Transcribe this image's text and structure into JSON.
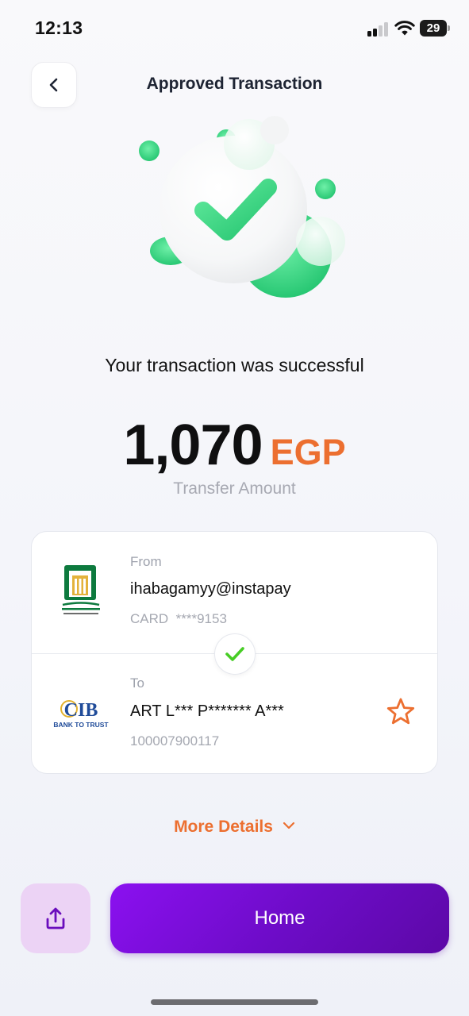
{
  "status_bar": {
    "time": "12:13",
    "battery": "29"
  },
  "header": {
    "title": "Approved Transaction"
  },
  "result": {
    "message": "Your transaction was successful",
    "amount": "1,070",
    "currency": "EGP",
    "amount_label": "Transfer Amount"
  },
  "transfer": {
    "from": {
      "label": "From",
      "account": "ihabagamyy@instapay",
      "meta_label": "CARD",
      "meta_value": "****9153",
      "bank_logo": "national-bank-of-egypt-logo"
    },
    "to": {
      "label": "To",
      "name": "ART L*** P******* A***",
      "account_number": "100007900117",
      "bank_logo": "cib-logo",
      "bank_logo_text": "CIB",
      "bank_tagline": "BANK TO TRUST"
    }
  },
  "more_details": {
    "label": "More Details"
  },
  "actions": {
    "home_label": "Home"
  },
  "colors": {
    "accent_orange": "#ec6f30",
    "primary_purple": "#7a0ed8",
    "share_bg": "#ecd3f5",
    "success_green": "#31d27f"
  }
}
